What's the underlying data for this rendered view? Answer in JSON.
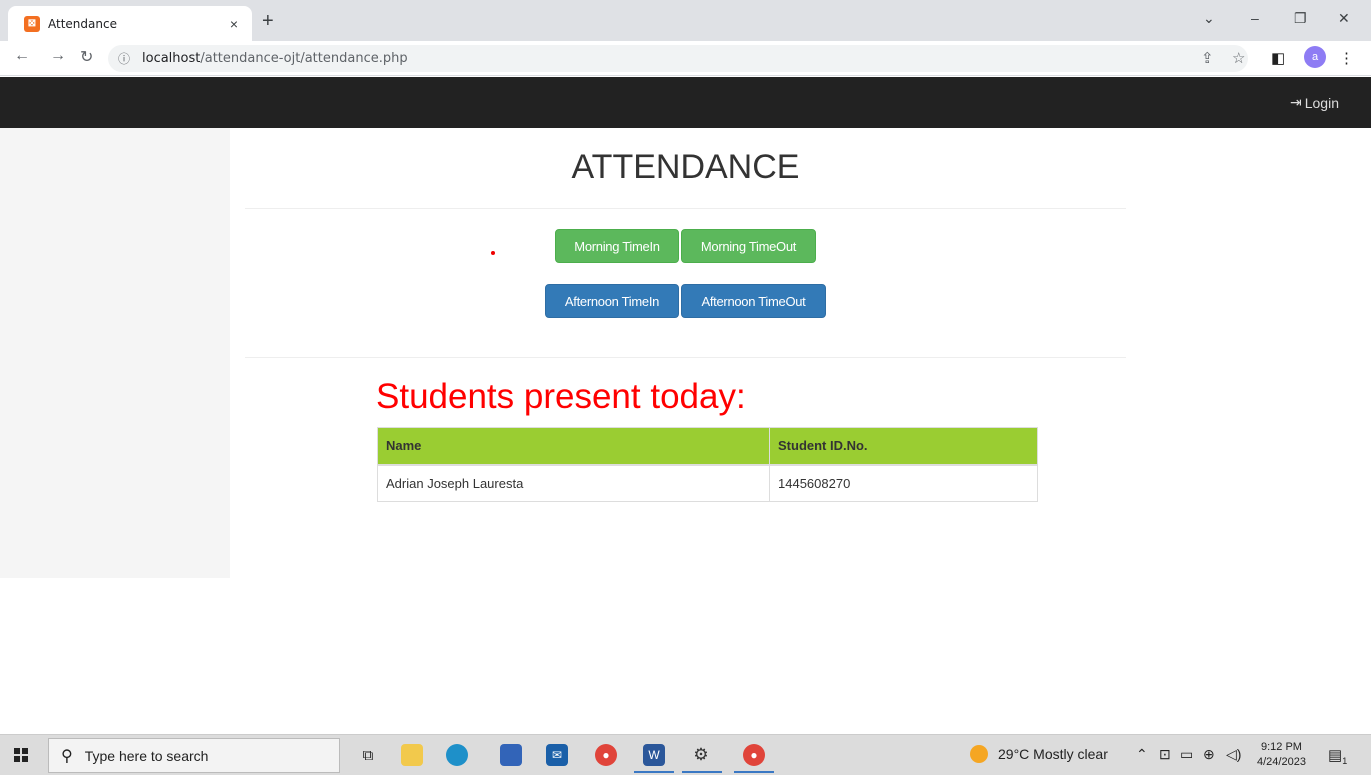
{
  "browser": {
    "tab_title": "Attendance",
    "tab_close": "×",
    "new_tab": "+",
    "url_host": "localhost",
    "url_path": "/attendance-ojt/attendance.php"
  },
  "navbar": {
    "login_label": "Login"
  },
  "page": {
    "heading": "ATTENDANCE",
    "buttons": {
      "morning_in": "Morning TimeIn",
      "morning_out": "Morning TimeOut",
      "afternoon_in": "Afternoon TimeIn",
      "afternoon_out": "Afternoon TimeOut"
    },
    "present_heading": "Students present today:",
    "table": {
      "headers": [
        "Name",
        "Student ID.No."
      ],
      "rows": [
        [
          "Adrian Joseph Lauresta",
          "1445608270"
        ]
      ]
    }
  },
  "taskbar": {
    "search_placeholder": "Type here to search",
    "weather": "29°C  Mostly clear",
    "time": "9:12 PM",
    "date": "4/24/2023",
    "notification_count": "1"
  },
  "colors": {
    "navbar_bg": "#222222",
    "btn_green": "#5cb85c",
    "btn_blue": "#337ab7",
    "table_header": "#9acd32",
    "present_heading": "#ff0000"
  }
}
